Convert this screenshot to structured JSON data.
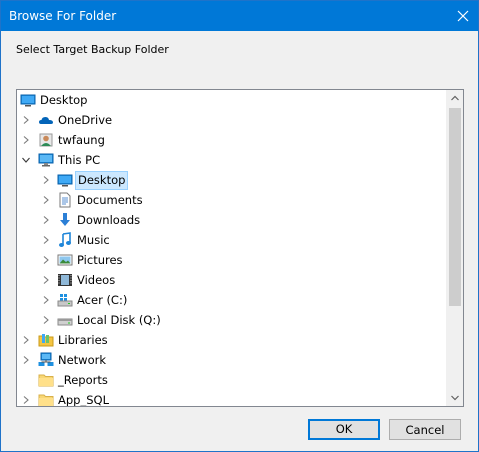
{
  "window": {
    "title": "Browse For Folder",
    "accent_color": "#0078d7"
  },
  "instruction": "Select Target Backup Folder",
  "tree": {
    "items": [
      {
        "label": "Desktop",
        "icon": "desktop-icon",
        "level": 0,
        "expander": "none",
        "selected": false
      },
      {
        "label": "OneDrive",
        "icon": "onedrive-icon",
        "level": 1,
        "expander": "collapsed",
        "selected": false
      },
      {
        "label": "twfaung",
        "icon": "user-icon",
        "level": 1,
        "expander": "collapsed",
        "selected": false
      },
      {
        "label": "This PC",
        "icon": "this-pc-icon",
        "level": 1,
        "expander": "expanded",
        "selected": false
      },
      {
        "label": "Desktop",
        "icon": "desktop-icon",
        "level": 2,
        "expander": "collapsed",
        "selected": true
      },
      {
        "label": "Documents",
        "icon": "documents-icon",
        "level": 2,
        "expander": "collapsed",
        "selected": false
      },
      {
        "label": "Downloads",
        "icon": "downloads-icon",
        "level": 2,
        "expander": "collapsed",
        "selected": false
      },
      {
        "label": "Music",
        "icon": "music-icon",
        "level": 2,
        "expander": "collapsed",
        "selected": false
      },
      {
        "label": "Pictures",
        "icon": "pictures-icon",
        "level": 2,
        "expander": "collapsed",
        "selected": false
      },
      {
        "label": "Videos",
        "icon": "videos-icon",
        "level": 2,
        "expander": "collapsed",
        "selected": false
      },
      {
        "label": "Acer (C:)",
        "icon": "windows-drive-icon",
        "level": 2,
        "expander": "collapsed",
        "selected": false
      },
      {
        "label": "Local Disk (Q:)",
        "icon": "drive-icon",
        "level": 2,
        "expander": "collapsed",
        "selected": false
      },
      {
        "label": "Libraries",
        "icon": "libraries-icon",
        "level": 1,
        "expander": "collapsed",
        "selected": false
      },
      {
        "label": "Network",
        "icon": "network-icon",
        "level": 1,
        "expander": "collapsed",
        "selected": false
      },
      {
        "label": "_Reports",
        "icon": "folder-icon",
        "level": 1,
        "expander": "none",
        "selected": false
      },
      {
        "label": "App_SQL",
        "icon": "folder-icon",
        "level": 1,
        "expander": "collapsed",
        "selected": false
      }
    ]
  },
  "buttons": {
    "ok": "OK",
    "cancel": "Cancel"
  }
}
